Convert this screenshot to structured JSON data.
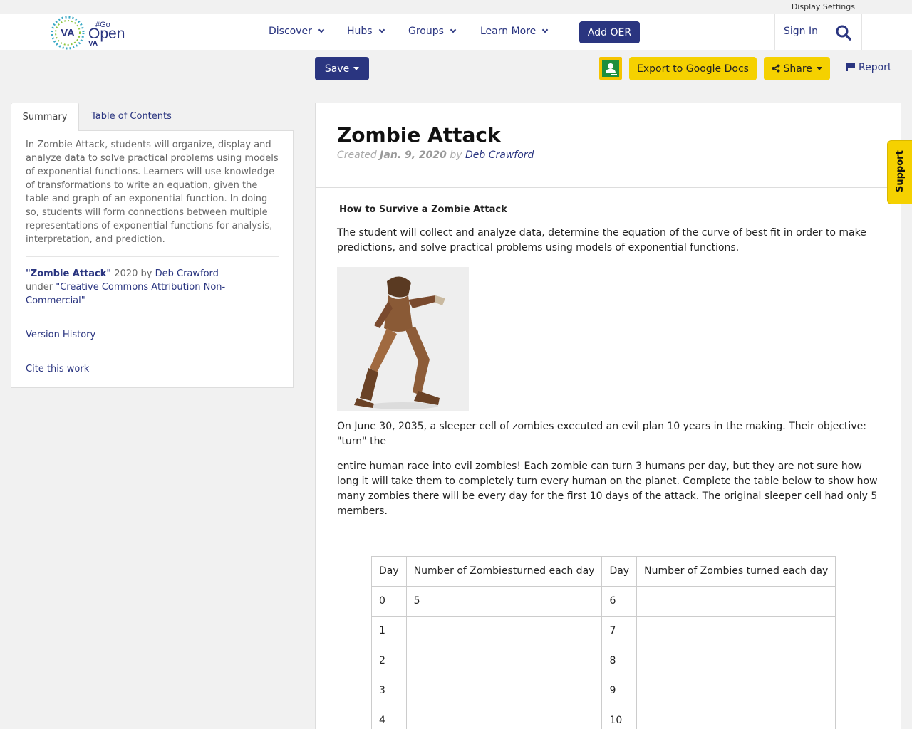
{
  "top": {
    "display_settings": "Display Settings"
  },
  "nav": {
    "logo_va": "VA",
    "logo_go": "#Go",
    "logo_open": "Open",
    "logo_va_small": "VA",
    "items": [
      {
        "label": "Discover"
      },
      {
        "label": "Hubs"
      },
      {
        "label": "Groups"
      },
      {
        "label": "Learn More"
      }
    ],
    "add_oer": "Add OER",
    "sign_in": "Sign In"
  },
  "toolbar": {
    "save": "Save",
    "export": "Export to Google Docs",
    "share": "Share",
    "report": "Report"
  },
  "sidebar": {
    "tabs": [
      "Summary",
      "Table of Contents"
    ],
    "summary": "In Zombie Attack, students will organize, display and analyze data to solve practical problems using models of exponential functions. Learners will use knowledge of transformations to write an equation, given the table and graph of an exponential function. In doing so, students will form connections between multiple representations of exponential functions for analysis, interpretation, and prediction.",
    "attribution": {
      "title": "\"Zombie Attack\"",
      "year_by": " 2020 by ",
      "author": "Deb Crawford",
      "under": "under ",
      "license": "\"Creative Commons Attribution Non-Commercial\""
    },
    "version_history": "Version History",
    "cite": "Cite this work"
  },
  "main": {
    "title": "Zombie Attack",
    "created_label": "Created ",
    "created_date": "Jan. 9, 2020",
    "by_label": " by ",
    "author": "Deb Crawford",
    "subhead": "How to Survive a Zombie Attack",
    "para1": "The student will collect and analyze data, determine the equation of the curve of best fit in order to make predictions, and solve practical problems using models of exponential functions.",
    "para2": "On June 30, 2035, a sleeper cell of zombies executed an evil plan 10 years in the making.  Their objective: \"turn\" the",
    "para3": "entire human race into evil zombies!  Each zombie can turn 3 humans per day, but they are not sure how long it will take them to completely turn every human on the planet.  Complete the table below to show how many zombies there will be every day for the first 10 days of the attack.  The original sleeper cell had only 5 members.",
    "table": {
      "headers": [
        "Day",
        "Number of Zombiesturned each day",
        "Day",
        "Number of Zombies turned each day"
      ],
      "rows": [
        [
          "0",
          "5",
          "6",
          ""
        ],
        [
          "1",
          "",
          "7",
          ""
        ],
        [
          "2",
          "",
          "8",
          ""
        ],
        [
          "3",
          "",
          "9",
          ""
        ],
        [
          "4",
          "",
          "10",
          ""
        ]
      ]
    }
  },
  "support": "Support",
  "colors": {
    "primary": "#2a3580",
    "accent": "#f5d100",
    "background": "#f1f1f1"
  }
}
